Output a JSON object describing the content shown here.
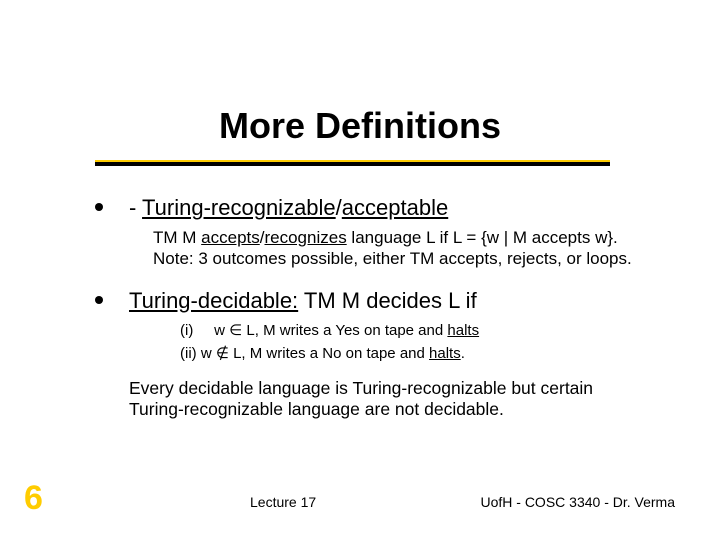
{
  "title": "More Definitions",
  "bullet1": {
    "lead": "  - ",
    "ul1": "Turing-recognizable",
    "slash": "/",
    "ul2": "acceptable"
  },
  "sub1": {
    "t1": "TM M ",
    "u1": "accepts",
    "t2": "/",
    "u2": "recognizes",
    "t3": " language L if L = {w | M accepts w}. Note: 3 outcomes possible, either TM accepts, rejects, or loops."
  },
  "bullet2": {
    "u1": "Turing-decidable:",
    "rest": " TM M decides L if"
  },
  "sub2": {
    "line1": {
      "num": "(i)",
      "gap": "    ",
      "t1": " w ",
      "sym": "∈",
      "t2": " L, M writes a Yes on tape and ",
      "u": "halts"
    },
    "line2": {
      "num": "(ii)",
      "t1": " w ",
      "sym": "∉",
      "t2": " L, M writes a No on tape and ",
      "u": "halts",
      "end": "."
    }
  },
  "closing": "Every decidable language is Turing-recognizable but certain Turing-recognizable  language are not decidable.",
  "slide_number": "6",
  "footer_center": "Lecture 17",
  "footer_right": "UofH - COSC 3340 - Dr. Verma"
}
